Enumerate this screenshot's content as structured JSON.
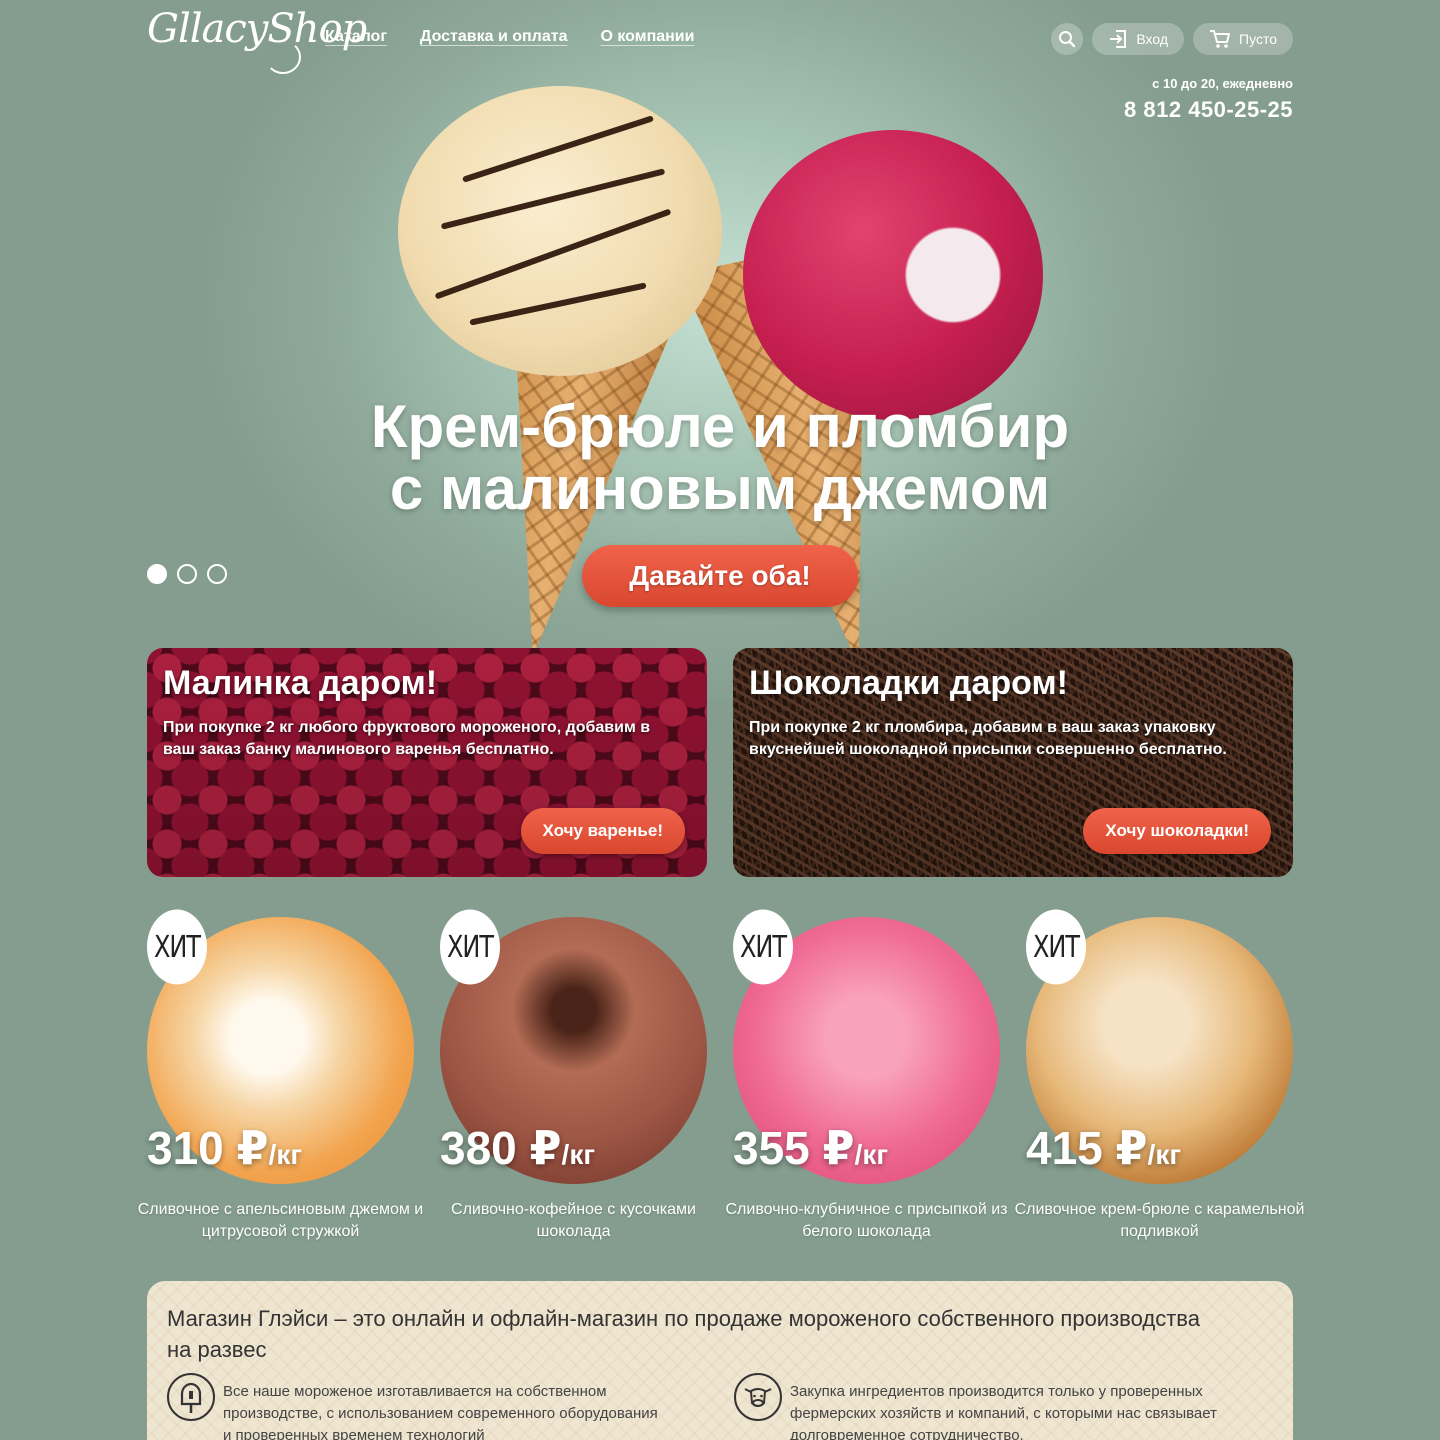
{
  "header": {
    "logo": "GllacyShop",
    "nav": [
      "Каталог",
      "Доставка и оплата",
      "О компании"
    ],
    "login_label": "Вход",
    "cart_label": "Пусто",
    "hours": "с 10 до 20, ежедневно",
    "phone": "8 812 450-25-25"
  },
  "hero": {
    "title_line1": "Крем-брюле и пломбир",
    "title_line2": "с малиновым джемом",
    "button": "Давайте оба!",
    "slides": 3,
    "active_slide": 1
  },
  "promos": [
    {
      "title": "Малинка даром!",
      "text": "При покупке 2 кг любого фруктового мороженого, добавим в ваш заказ банку малинового варенья бесплатно.",
      "button": "Хочу варенье!"
    },
    {
      "title": "Шоколадки даром!",
      "text": "При покупке 2 кг пломбира, добавим в ваш заказ упаковку вкуснейшей шоколадной присыпки совершенно бесплатно.",
      "button": "Хочу шоколадки!"
    }
  ],
  "products": [
    {
      "badge": "ХИТ",
      "price": "310 ₽",
      "unit": "/кг",
      "name": "Сливочное с апельсиновым джемом и цитрусовой стружкой"
    },
    {
      "badge": "ХИТ",
      "price": "380 ₽",
      "unit": "/кг",
      "name": "Сливочно-кофейное с кусочками шоколада"
    },
    {
      "badge": "ХИТ",
      "price": "355 ₽",
      "unit": "/кг",
      "name": "Сливочно-клубничное с присыпкой из белого шоколада"
    },
    {
      "badge": "ХИТ",
      "price": "415 ₽",
      "unit": "/кг",
      "name": "Сливочное крем-брюле с карамельной подливкой"
    }
  ],
  "about": {
    "title": "Магазин Глэйси – это онлайн и офлайн-магазин по продаже мороженого собственного производства на развес",
    "features": [
      {
        "icon": "popsicle-icon",
        "text": "Все наше мороженое изготавливается на собственном производстве, с использованием современного оборудования и проверенных временем технологий"
      },
      {
        "icon": "cow-icon",
        "text": "Закупка ингредиентов производится только у проверенных фермерских хозяйств и компаний, с которыми нас связывает долговременное сотрудничество."
      }
    ]
  },
  "colors": {
    "background": "#849d8e",
    "accent": "#e5523a",
    "about_bg": "#efe6d2"
  }
}
